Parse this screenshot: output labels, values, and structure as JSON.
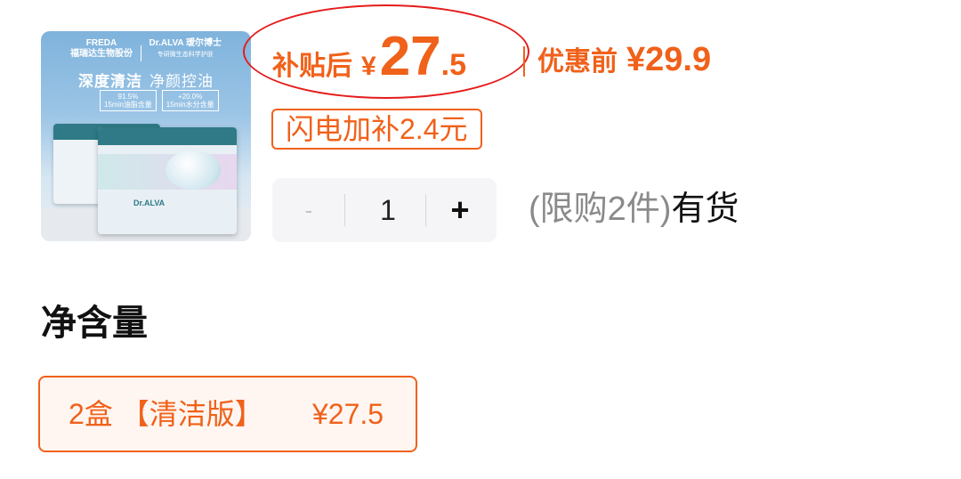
{
  "product_image": {
    "brand_left": "FREDA",
    "brand_left_sub": "福瑞达生物股份",
    "brand_right": "Dr.ALVA",
    "brand_right_cn": "瑷尔博士",
    "brand_right_sub": "专研微生态科学护肤",
    "headline_strong": "深度清洁",
    "headline": "净颜控油",
    "stat1_value": "91.5%",
    "stat1_label": "15min油脂含量",
    "stat2_value": "+20.0%",
    "stat2_label": "15min水分含量",
    "box_brand": "Dr.ALVA"
  },
  "price": {
    "after_subsidy_label": "补贴后",
    "currency": "¥",
    "after_subsidy_integer": "27",
    "after_subsidy_decimal": ".5",
    "before_discount_label": "优惠前",
    "before_discount_value": "¥29.9",
    "flash_subsidy": "闪电加补2.4元"
  },
  "quantity": {
    "minus": "-",
    "value": "1",
    "plus": "+"
  },
  "stock": {
    "limit": "(限购2件)",
    "status": "有货"
  },
  "spec": {
    "section_title": "净含量",
    "options": [
      {
        "name": "2盒 【清洁版】",
        "price": "¥27.5",
        "selected": true
      }
    ]
  },
  "colors": {
    "accent": "#f0611a",
    "annotation_circle": "#e51c1c"
  }
}
